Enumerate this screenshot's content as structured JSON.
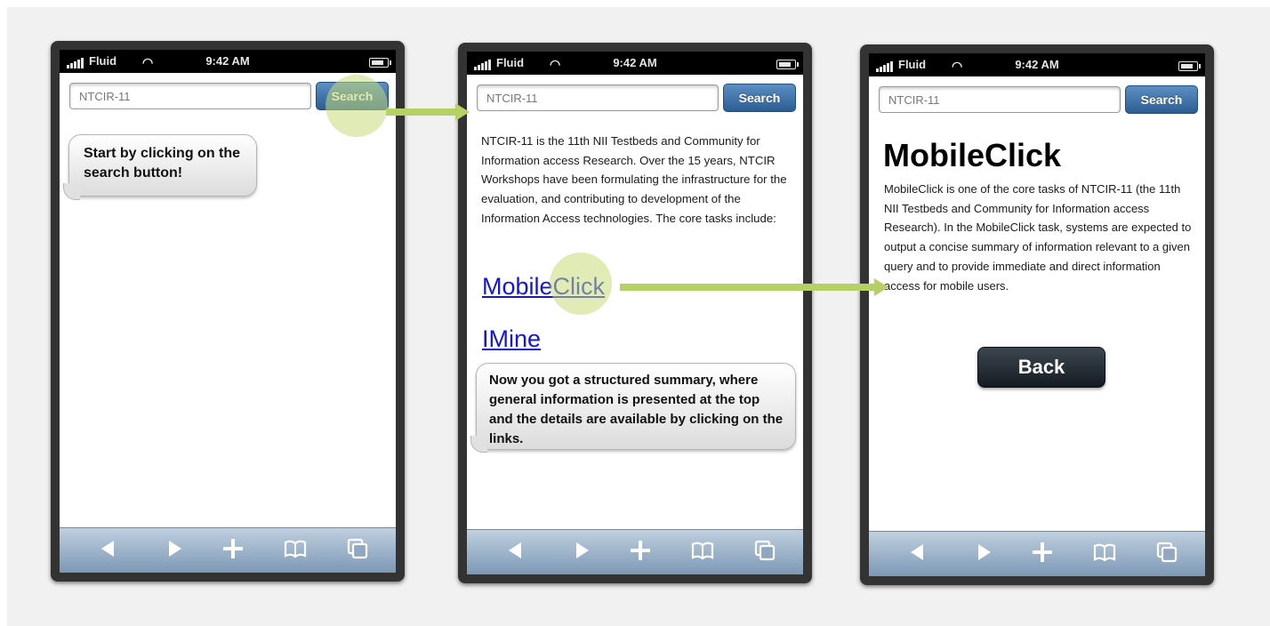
{
  "statusbar": {
    "carrier": "Fluid",
    "time": "9:42 AM"
  },
  "search": {
    "value": "NTCIR-11",
    "button_label": "Search"
  },
  "phone1": {
    "bubble_text": "Start by clicking on the search button!"
  },
  "phone2": {
    "intro": "NTCIR-11 is the 11th NII Testbeds and Community for Information access Research. Over the 15 years, NTCIR Workshops have been formulating the infrastructure for the evaluation, and contributing to development of the Information Access technologies. The core tasks include:",
    "links": [
      "MobileClick",
      "IMine"
    ],
    "bubble_text": "Now you got a structured summary, where general information is presented at the top and the details are available by clicking on the links."
  },
  "phone3": {
    "title": "MobileClick",
    "description": "MobileClick is one of the core tasks of NTCIR-11 (the 11th NII Testbeds and Community for Information access Research). In the MobileClick task, systems are expected to output a concise summary of information relevant to a given query and to provide immediate and direct information access for mobile users.",
    "back_label": "Back"
  },
  "toolbar": {
    "icons": [
      "back-arrow-icon",
      "forward-arrow-icon",
      "add-icon",
      "bookmarks-icon",
      "pages-icon"
    ]
  },
  "colors": {
    "highlight": "#c6da78",
    "arrow": "#b5d165",
    "search_button": "#2c5d93",
    "link": "#1515d6"
  }
}
